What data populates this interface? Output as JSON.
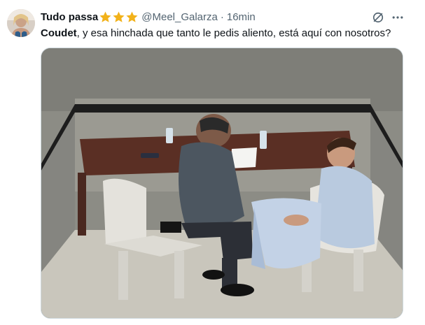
{
  "tweet": {
    "display_name": "Tudo passa",
    "stars": [
      "star-icon",
      "star-icon",
      "star-icon"
    ],
    "star_color": "#f2b21a",
    "handle": "@Meel_Galarza",
    "separator": "·",
    "time": "16min",
    "mention": "Coudet",
    "body": ", y esa hinchada que tanto le pedis aliento, está aquí con nosotros?",
    "media": {
      "alt": "interrogation-room-photo"
    },
    "icons": {
      "avatar": "avatar",
      "grok": "grok-icon",
      "more": "more-icon"
    }
  }
}
